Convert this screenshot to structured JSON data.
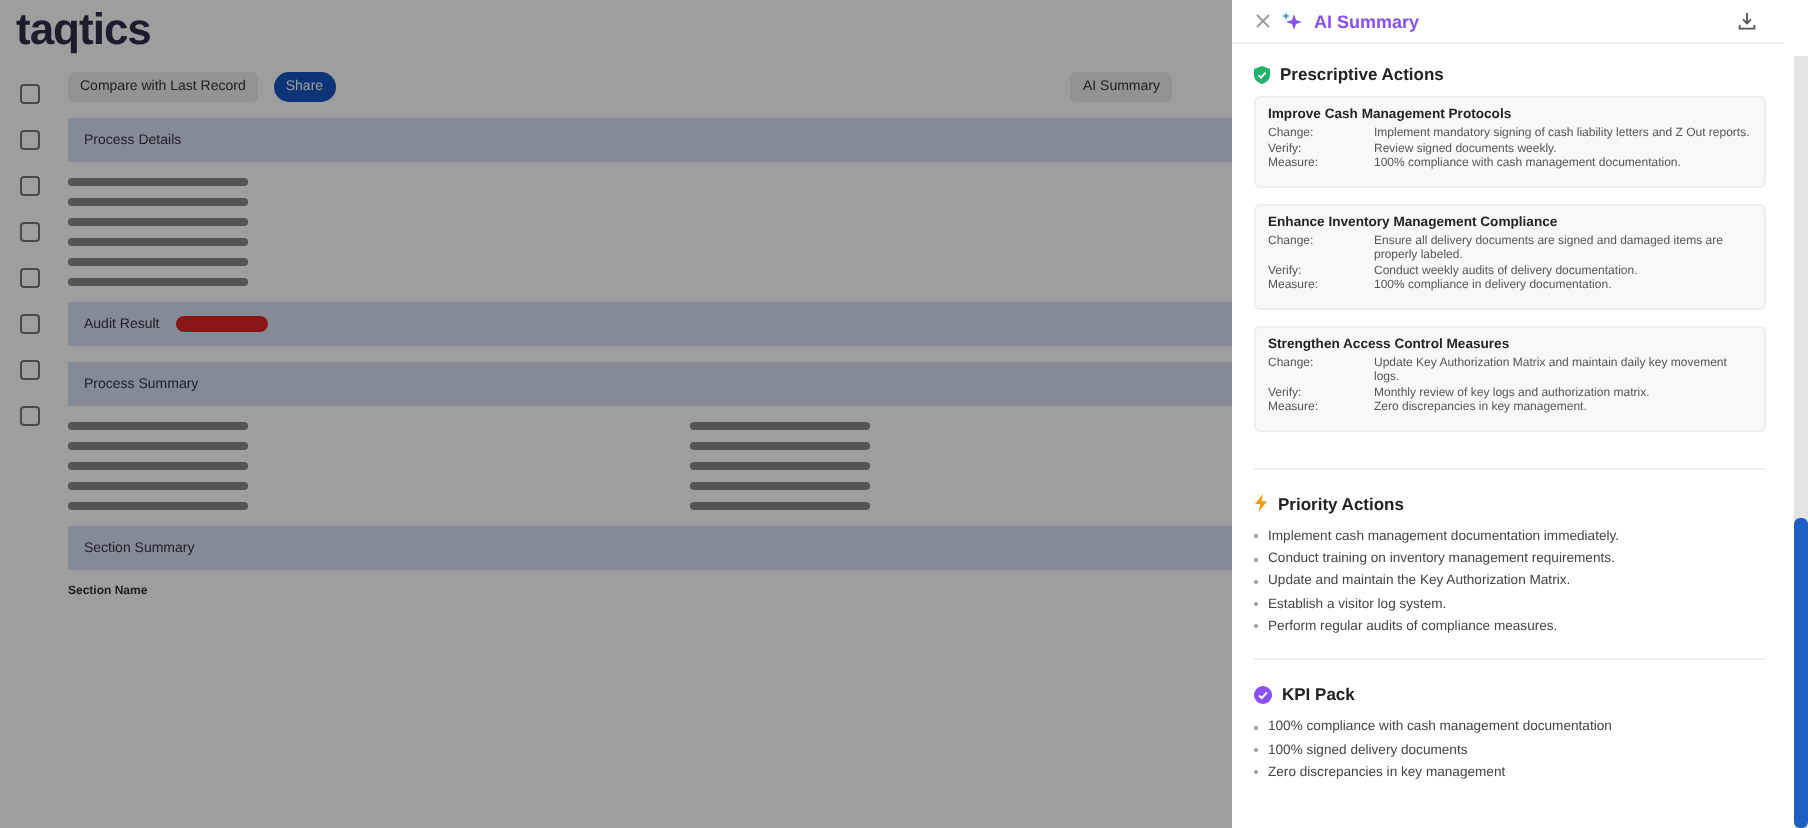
{
  "background": {
    "logo": "taqtics",
    "toolbar": [
      {
        "label": "Compare with Last Record",
        "kind": "plain"
      },
      {
        "label": "Share",
        "kind": "primary"
      },
      {
        "label": "AI Summary",
        "kind": "plain"
      }
    ],
    "sections": [
      {
        "title": "Process Details"
      },
      {
        "title": "Audit Result"
      },
      {
        "title": "Process Summary"
      },
      {
        "title": "Section Summary"
      }
    ],
    "table_header": "Section Name"
  },
  "drawer": {
    "title": "AI Summary",
    "sections": [
      {
        "kind": "cards",
        "title": "Prescriptive Actions",
        "cards": [
          {
            "title": "Improve Cash Management Protocols",
            "rows": [
              {
                "label": "Change:",
                "text": "Implement mandatory signing of cash liability letters and Z Out reports."
              },
              {
                "label": "Verify:",
                "text": "Review signed documents weekly."
              },
              {
                "label": "Measure:",
                "text": "100% compliance with cash management documentation."
              }
            ]
          },
          {
            "title": "Enhance Inventory Management Compliance",
            "rows": [
              {
                "label": "Change:",
                "text": "Ensure all delivery documents are signed and damaged items are properly labeled."
              },
              {
                "label": "Verify:",
                "text": "Conduct weekly audits of delivery documentation."
              },
              {
                "label": "Measure:",
                "text": "100% compliance in delivery documentation."
              }
            ]
          },
          {
            "title": "Strengthen Access Control Measures",
            "rows": [
              {
                "label": "Change:",
                "text": "Update Key Authorization Matrix and maintain daily key movement logs."
              },
              {
                "label": "Verify:",
                "text": "Monthly review of key logs and authorization matrix."
              },
              {
                "label": "Measure:",
                "text": "Zero discrepancies in key management."
              }
            ]
          }
        ]
      },
      {
        "kind": "list",
        "title": "Priority Actions",
        "items": [
          "Implement cash management documentation immediately.",
          "Conduct training on inventory management requirements.",
          "Update and maintain the Key Authorization Matrix.",
          "Establish a visitor log system.",
          "Perform regular audits of compliance measures."
        ]
      },
      {
        "kind": "list",
        "title": "KPI Pack",
        "items": [
          "100% compliance with cash management documentation",
          "100% signed delivery documents",
          "Zero discrepancies in key management"
        ]
      }
    ]
  }
}
